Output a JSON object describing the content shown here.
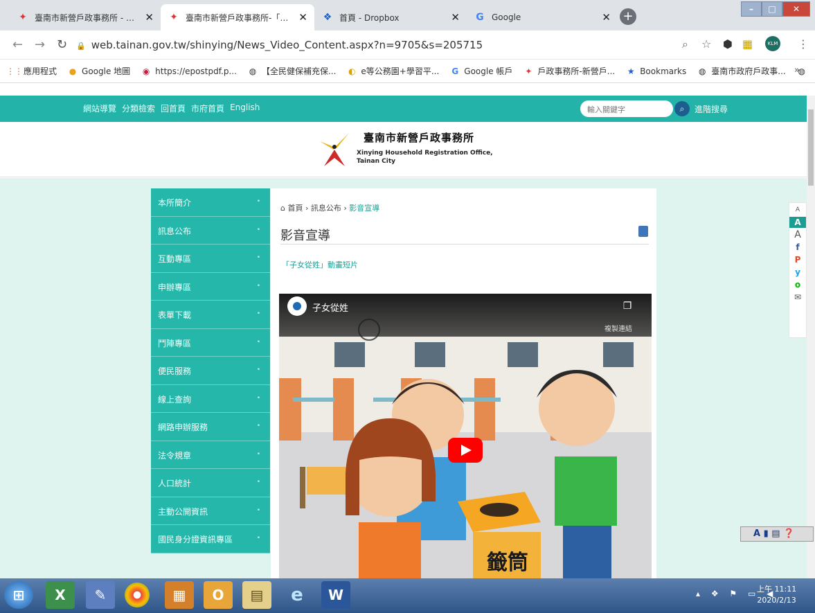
{
  "browser": {
    "tabs": [
      {
        "title": "臺南市新營戶政事務所 - 全站搜尋",
        "active": false,
        "icon": "flag-logo-icon"
      },
      {
        "title": "臺南市新營戶政事務所-「子女從姓",
        "active": true,
        "icon": "flag-logo-icon"
      },
      {
        "title": "首頁 - Dropbox",
        "active": false,
        "icon": "dropbox-icon"
      },
      {
        "title": "Google",
        "active": false,
        "icon": "google-icon"
      }
    ],
    "url": "web.tainan.gov.tw/shinying/News_Video_Content.aspx?n=9705&s=205715",
    "bookmarks": [
      {
        "label": "應用程式",
        "icon": "apps-grid-icon"
      },
      {
        "label": "Google 地圖",
        "icon": "maps-pin-icon"
      },
      {
        "label": "https://epostpdf.p...",
        "icon": "post-icon"
      },
      {
        "label": "【全民健保補充保...",
        "icon": "globe-icon"
      },
      {
        "label": "e等公務園+學習平...",
        "icon": "elearn-icon"
      },
      {
        "label": "Google 帳戶",
        "icon": "google-icon"
      },
      {
        "label": "戶政事務所-新營戶...",
        "icon": "flag-logo-icon"
      },
      {
        "label": "Bookmarks",
        "icon": "star-icon"
      },
      {
        "label": "臺南市政府戶政事...",
        "icon": "globe-icon"
      },
      {
        "label": "",
        "icon": "globe-icon"
      }
    ],
    "bookmarks_more": "»",
    "profile_initials": "KLM"
  },
  "site": {
    "topnav_links": [
      "網站導覽",
      "分類檢索",
      "回首頁",
      "市府首頁",
      "English"
    ],
    "search_placeholder": "輸入關鍵字",
    "advanced_search": "進階搜尋",
    "logo_zh": "臺南市新營戶政事務所",
    "logo_en_line1": "Xinying Household Registration Office,",
    "logo_en_line2": "Tainan City"
  },
  "sidebar": {
    "items": [
      "本所簡介",
      "訊息公布",
      "互動專區",
      "申辦專區",
      "表單下載",
      "鬥陣專區",
      "便民服務",
      "線上查詢",
      "網路申辦服務",
      "法令規章",
      "人口統計",
      "主動公開資訊",
      "國民身分證資訊專區"
    ]
  },
  "content": {
    "breadcrumb": [
      "首頁",
      "訊息公布",
      "影音宣導"
    ],
    "title": "影音宣導",
    "subtitle": "「子女從姓」動畫短片",
    "video_title": "子女從姓",
    "video_copy_link": "複製連結",
    "video_box_text": "籤筒"
  },
  "share": [
    "A",
    "A",
    "A",
    "f",
    "P",
    "y",
    "o",
    "✉"
  ],
  "taskbar": {
    "time": "上午 11:11",
    "date": "2020/2/13"
  }
}
